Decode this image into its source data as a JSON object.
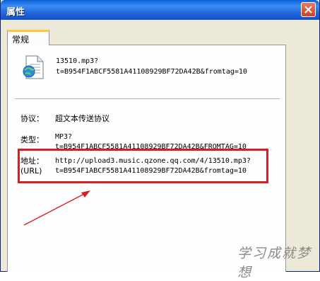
{
  "window": {
    "title": "属性"
  },
  "tabs": [
    {
      "label": "常规"
    }
  ],
  "file": {
    "name_line1": "13510.mp3?",
    "name_line2": "t=B954F1ABCF5581A41108929BF72DA42B&fromtag=10"
  },
  "protocol": {
    "label": "协议：",
    "value": "超文本传送协议"
  },
  "type": {
    "label": "类型：",
    "value_line1": "MP3?",
    "value_line2": "t=B954F1ABCF5581A41108929BF72DA42B&FROMTAG=10"
  },
  "address": {
    "label_line1": "地址：",
    "label_line2": "(URL)",
    "value_line1": "http://upload3.music.qzone.qq.com/4/13510.mp3?",
    "value_line2": "t=B954F1ABCF5581A41108929BF72DA42B&fromtag=10"
  },
  "watermark": "学习成就梦想",
  "colors": {
    "highlight": "#d42020",
    "titlebar": "#1e63d6"
  }
}
